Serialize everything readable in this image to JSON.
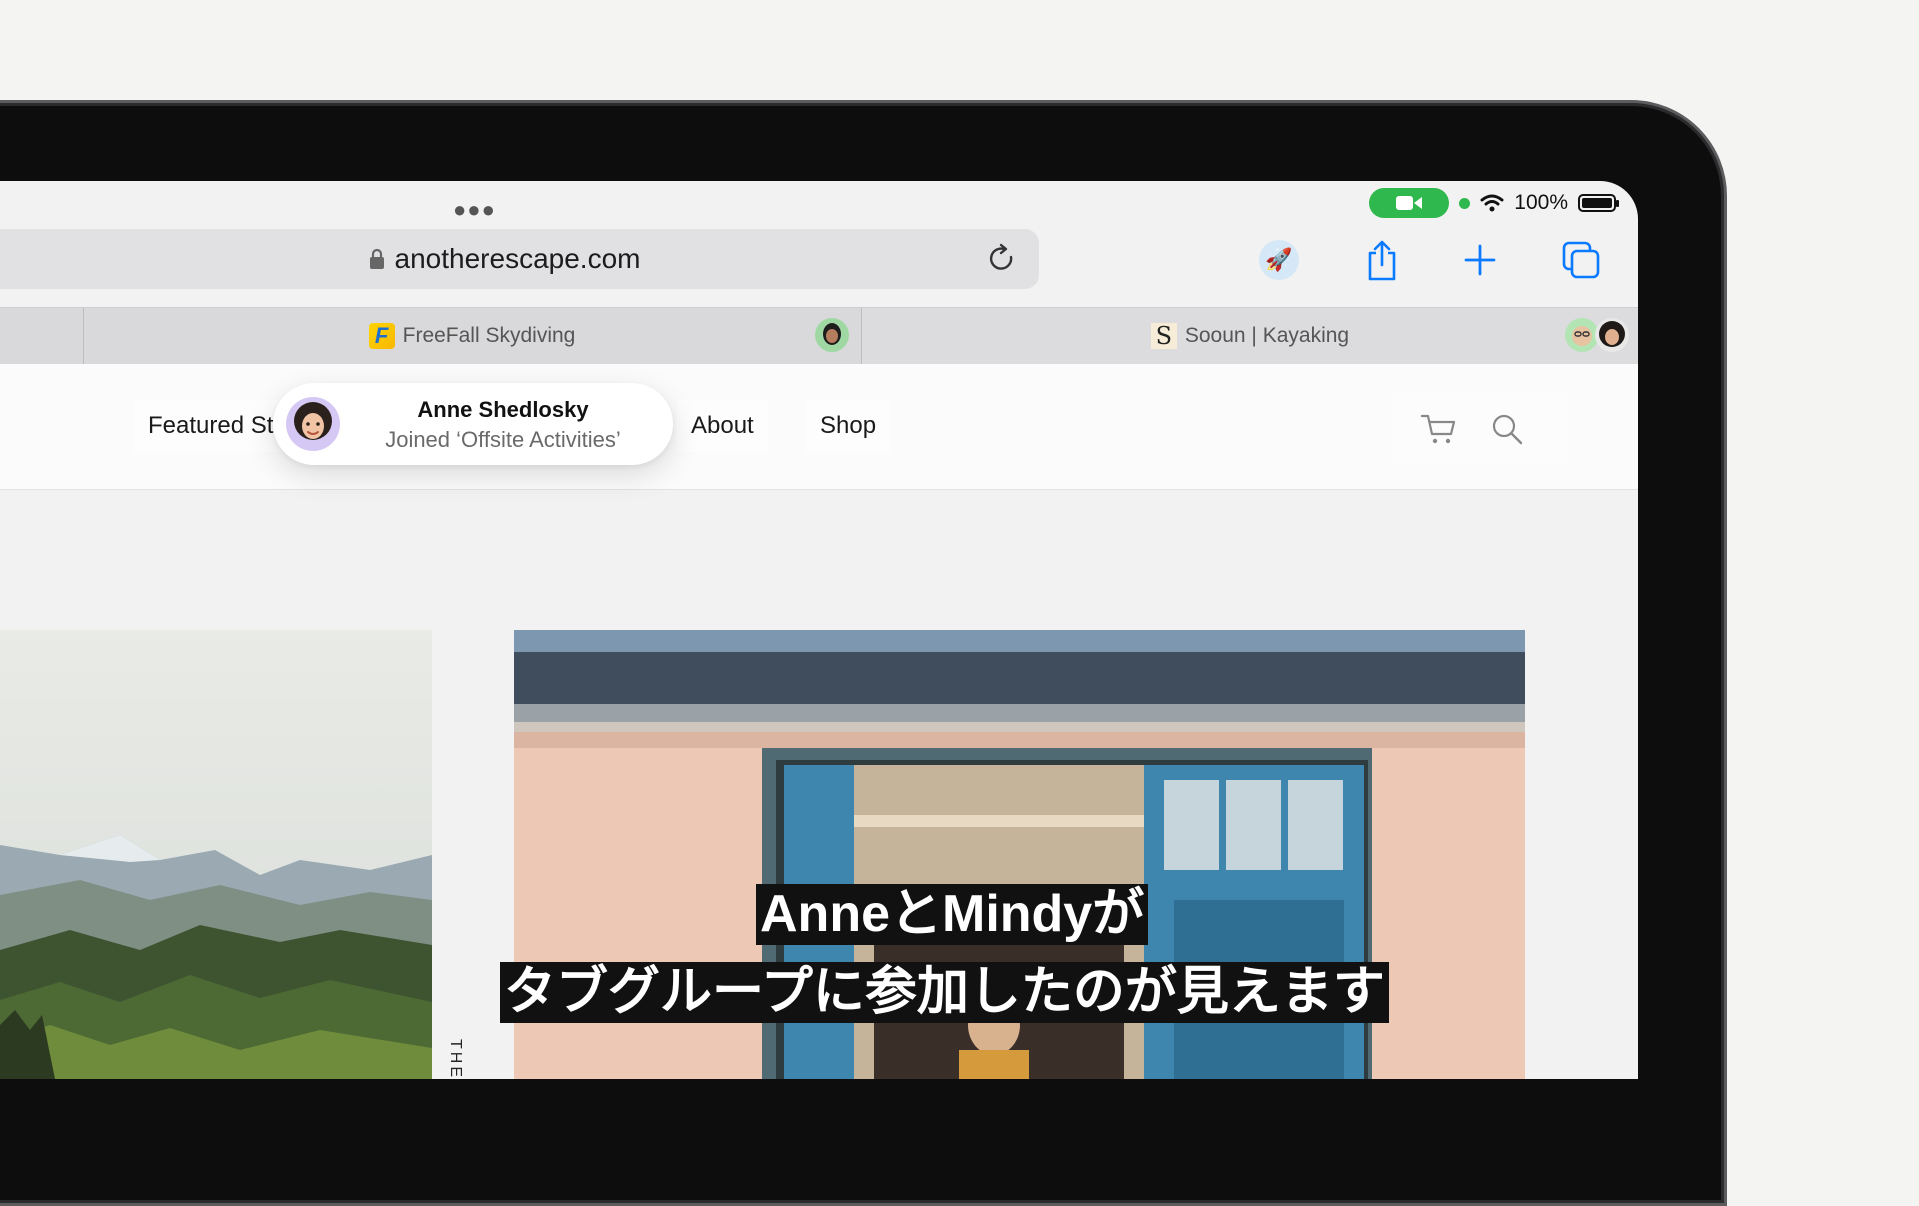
{
  "browser": {
    "url": "anotherescape.com",
    "status": {
      "battery_percent": "100%"
    },
    "tabs": [
      {
        "title": "FreeFall Skydiving",
        "favicon_letter": "F"
      },
      {
        "title": "Sooun | Kayaking",
        "favicon_letter": "S"
      }
    ]
  },
  "site": {
    "nav": {
      "featured_label": "Featured St",
      "about_label": "About",
      "shop_label": "Shop"
    }
  },
  "notification": {
    "name": "Anne Shedlosky",
    "message": "Joined ‘Offsite Activities’"
  },
  "content": {
    "vertical_caption": "THE"
  },
  "subtitles": {
    "line1": "AnneとMindyが",
    "line2": "タブグループに参加したのが見えます"
  },
  "colors": {
    "accent": "#0a7aff",
    "facetime_green": "#2fb84d"
  }
}
